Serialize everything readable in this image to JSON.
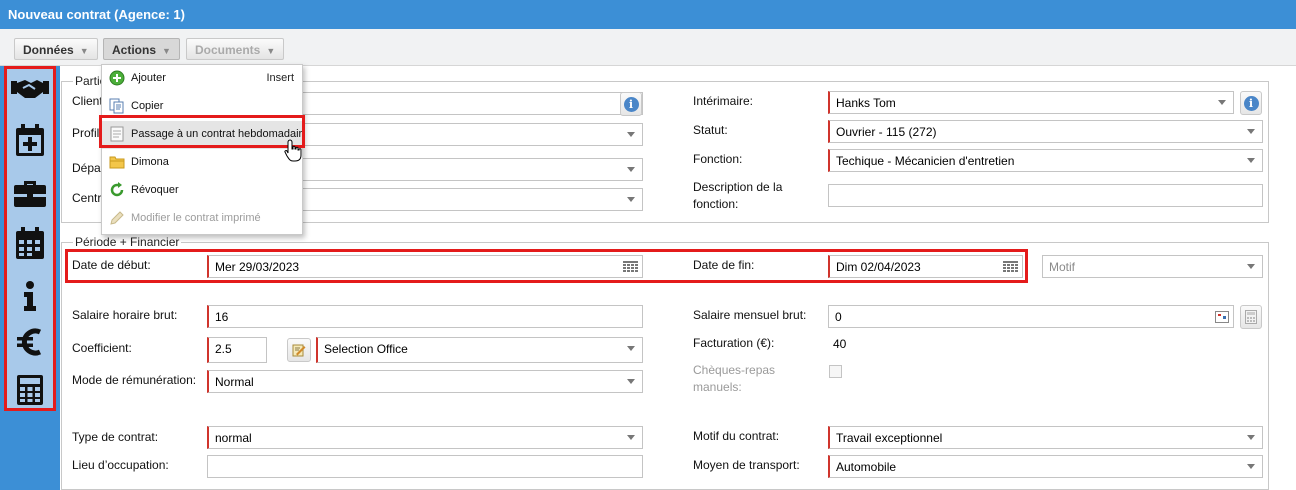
{
  "window": {
    "title": "Nouveau contrat (Agence: 1)"
  },
  "toolbar": {
    "donnees": "Données",
    "actions": "Actions",
    "documents": "Documents"
  },
  "sidebar": {
    "icons": [
      "handshake-icon",
      "calendar-plus-icon",
      "briefcase-icon",
      "calendar-icon",
      "info-icon",
      "euro-icon",
      "calculator-icon"
    ]
  },
  "actions_menu": {
    "items": [
      {
        "label": "Ajouter",
        "shortcut": "Insert",
        "icon": "add-icon"
      },
      {
        "label": "Copier",
        "icon": "copy-icon"
      },
      {
        "label": "Passage à un contrat hebdomadair",
        "icon": "document-icon",
        "highlighted": true
      },
      {
        "label": "Dimona",
        "icon": "folder-icon"
      },
      {
        "label": "Révoquer",
        "icon": "revoke-icon"
      },
      {
        "label": "Modifier le contrat imprimé",
        "icon": "pencil-icon",
        "disabled": true
      }
    ]
  },
  "parties": {
    "legend": "Partie",
    "client_label": "Client",
    "profil_label": "Profil",
    "departement_label": "Dépar",
    "centre_label": "Centre",
    "interimaire_label": "Intérimaire:",
    "interimaire_value": "Hanks Tom",
    "statut_label": "Statut:",
    "statut_value": "Ouvrier - 115 (272)",
    "fonction_label": "Fonction:",
    "fonction_value": "Techique - Mécanicien d'entretien",
    "description_label": "Description de la fonction:",
    "description_value": ""
  },
  "periode": {
    "legend": "Période + Financier",
    "date_debut_label": "Date de début:",
    "date_debut_value": "Mer 29/03/2023",
    "date_fin_label": "Date de fin:",
    "date_fin_value": "Dim 02/04/2023",
    "motif_placeholder": "Motif",
    "salaire_horaire_label": "Salaire horaire brut:",
    "salaire_horaire_value": "16",
    "salaire_mensuel_label": "Salaire mensuel brut:",
    "salaire_mensuel_value": "0",
    "coefficient_label": "Coefficient:",
    "coefficient_value": "2.5",
    "coefficient_select": "Selection Office",
    "facturation_label": "Facturation (€):",
    "facturation_value": "40",
    "mode_remuneration_label": "Mode de rémunération:",
    "mode_remuneration_value": "Normal",
    "cheques_repas_label": "Chèques-repas manuels:",
    "type_contrat_label": "Type de contrat:",
    "type_contrat_value": "normal",
    "motif_contrat_label": "Motif du contrat:",
    "motif_contrat_value": "Travail exceptionnel",
    "lieu_label": "Lieu d’occupation:",
    "lieu_value": "",
    "transport_label": "Moyen de transport:",
    "transport_value": "Automobile"
  }
}
